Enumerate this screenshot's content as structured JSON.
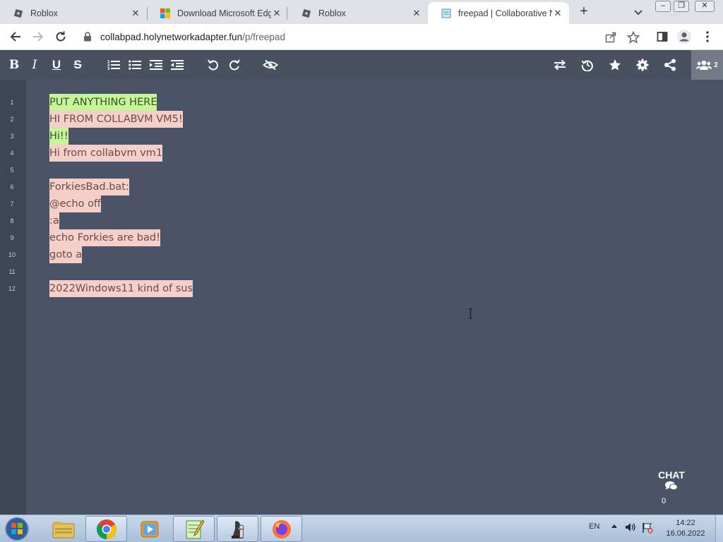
{
  "browser": {
    "tabs": [
      {
        "title": "Roblox",
        "icon": "roblox-icon",
        "active": false
      },
      {
        "title": "Download Microsoft Edge",
        "icon": "microsoft-icon",
        "active": false
      },
      {
        "title": "Roblox",
        "icon": "roblox-icon",
        "active": false
      },
      {
        "title": "freepad | Collaborative N",
        "icon": "notepad-icon",
        "active": true
      }
    ],
    "new_tab_label": "+",
    "window_buttons": {
      "minimize": "–",
      "restore": "❐",
      "close": "✕"
    },
    "url_host": "collabpad.holynetworkadapter.fun",
    "url_path": "/p/freepad"
  },
  "padbar": {
    "left_buttons": [
      {
        "name": "bold",
        "glyph": "B"
      },
      {
        "name": "italic",
        "glyph": "I"
      },
      {
        "name": "underline",
        "glyph": "U"
      },
      {
        "name": "strikethrough",
        "glyph": "S"
      },
      {
        "name": "ordered-list",
        "glyph": ""
      },
      {
        "name": "unordered-list",
        "glyph": ""
      },
      {
        "name": "indent",
        "glyph": ""
      },
      {
        "name": "outdent",
        "glyph": ""
      },
      {
        "name": "undo",
        "glyph": ""
      },
      {
        "name": "redo",
        "glyph": ""
      },
      {
        "name": "clear-authorship",
        "glyph": ""
      }
    ],
    "right_buttons": [
      "import-export",
      "timeslider",
      "saved-revision",
      "settings",
      "share"
    ],
    "users_count": "2"
  },
  "editor": {
    "lines": [
      {
        "num": "1",
        "text": "PUT ANYTHING HERE",
        "highlight": "green"
      },
      {
        "num": "2",
        "text": "HI FROM COLLABVM VM5!",
        "highlight": "pink"
      },
      {
        "num": "3",
        "text": "Hi!!",
        "highlight": "green"
      },
      {
        "num": "4",
        "text": "Hi from collabvm vm1",
        "highlight": "pink"
      },
      {
        "num": "5",
        "text": "",
        "highlight": "none"
      },
      {
        "num": "6",
        "text": "ForkiesBad.bat:",
        "highlight": "pink"
      },
      {
        "num": "7",
        "text": "@echo off",
        "highlight": "pink"
      },
      {
        "num": "8",
        "text": ":a",
        "highlight": "pink"
      },
      {
        "num": "9",
        "text": "echo Forkies are bad!",
        "highlight": "pink"
      },
      {
        "num": "10",
        "text": "goto a",
        "highlight": "pink"
      },
      {
        "num": "11",
        "text": "",
        "highlight": "none"
      },
      {
        "num": "12",
        "text": "2022Windows11 kind of sus",
        "highlight": "pink"
      }
    ]
  },
  "chat": {
    "label": "CHAT",
    "count": "0"
  },
  "taskbar": {
    "pinned": [
      "explorer-icon",
      "chrome-icon",
      "media-player-icon",
      "notepad-plus-icon",
      "chess-icon",
      "firefox-icon"
    ],
    "language": "EN",
    "time": "14:22",
    "date": "16.06.2022"
  },
  "colors": {
    "editor_bg": "#4a5466",
    "toolbar_bg": "#485160",
    "highlight_green": "#c5f598",
    "highlight_pink": "#f5cfca"
  }
}
